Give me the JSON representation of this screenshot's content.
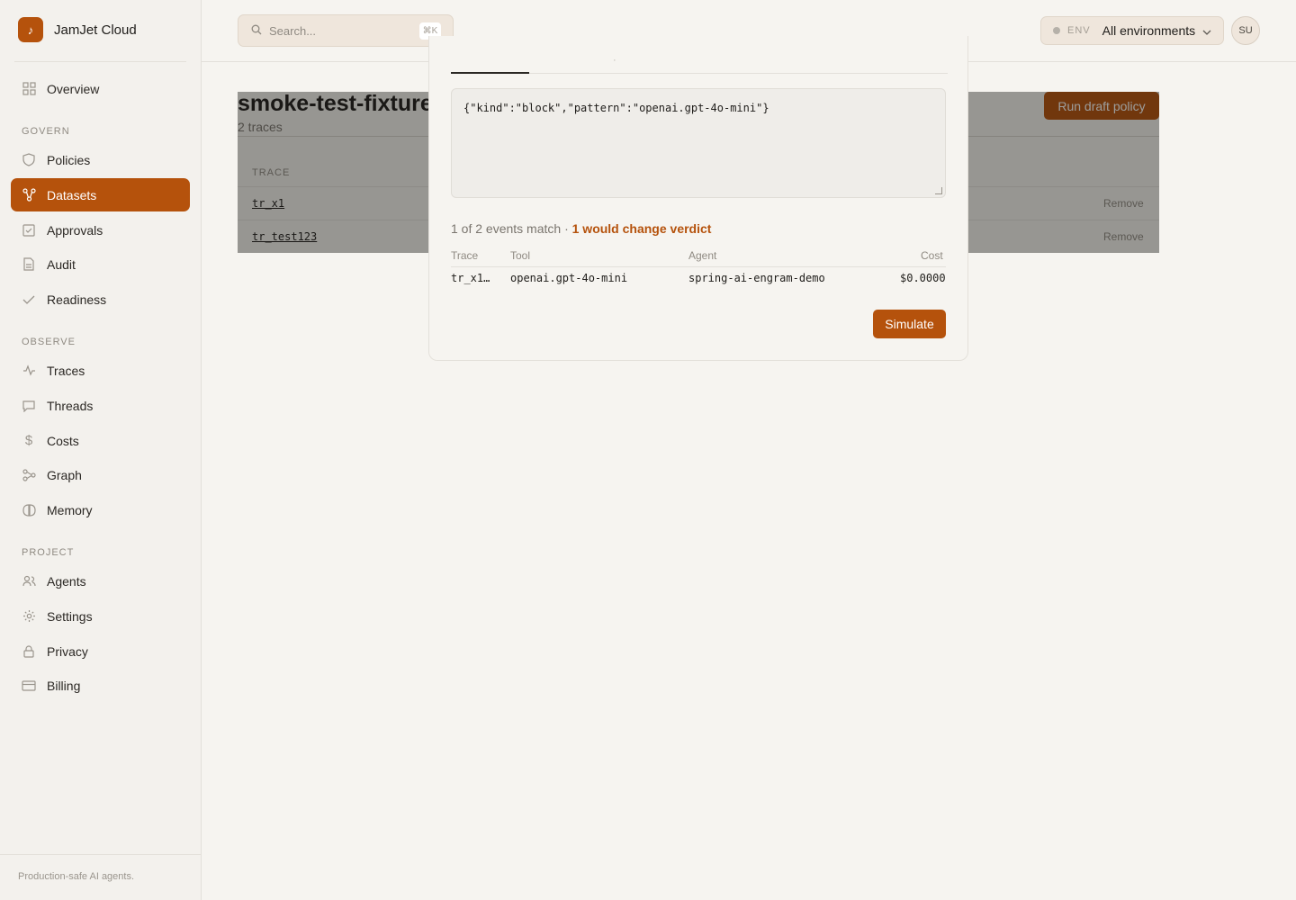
{
  "brand": {
    "name": "JamJet Cloud",
    "logo_glyph": "♪"
  },
  "sidebar": {
    "sections": {
      "govern": "GOVERN",
      "observe": "OBSERVE",
      "project": "PROJECT"
    },
    "items": [
      {
        "label": "Overview",
        "icon": "grid-icon"
      },
      {
        "label": "Policies",
        "icon": "shield-icon"
      },
      {
        "label": "Datasets",
        "icon": "dataset-icon",
        "active": true
      },
      {
        "label": "Approvals",
        "icon": "check-square-icon"
      },
      {
        "label": "Audit",
        "icon": "file-icon"
      },
      {
        "label": "Readiness",
        "icon": "check-icon"
      },
      {
        "label": "Traces",
        "icon": "activity-icon"
      },
      {
        "label": "Threads",
        "icon": "message-icon"
      },
      {
        "label": "Costs",
        "icon": "dollar-icon"
      },
      {
        "label": "Graph",
        "icon": "graph-icon"
      },
      {
        "label": "Memory",
        "icon": "memory-icon"
      },
      {
        "label": "Agents",
        "icon": "users-icon"
      },
      {
        "label": "Settings",
        "icon": "gear-icon"
      },
      {
        "label": "Privacy",
        "icon": "lock-icon"
      },
      {
        "label": "Billing",
        "icon": "card-icon"
      }
    ],
    "footer": "Production-safe AI agents."
  },
  "topbar": {
    "search_placeholder": "Search...",
    "search_shortcut": "⌘K",
    "env_label": "ENV",
    "env_value": "All environments",
    "avatar_initials": "SU"
  },
  "dataset": {
    "title": "smoke-test-fixture",
    "subtitle": "2 traces",
    "run_button": "Run draft policy",
    "column_trace": "TRACE",
    "rows": [
      {
        "trace": "tr_x1",
        "action": "Remove"
      },
      {
        "trace": "tr_test123",
        "action": "Remove"
      }
    ]
  },
  "modal": {
    "policy_json": "{\"kind\":\"block\",\"pattern\":\"openai.gpt-4o-mini\"}",
    "summary_text": "1 of 2 events match · ",
    "summary_warn": "1 would change verdict",
    "columns": {
      "trace": "Trace",
      "tool": "Tool",
      "agent": "Agent",
      "cost": "Cost"
    },
    "result": {
      "trace": "tr_x1…",
      "tool": "openai.gpt-4o-mini",
      "agent": "spring-ai-engram-demo",
      "cost": "$0.0000"
    },
    "simulate_button": "Simulate"
  },
  "colors": {
    "accent": "#b5520c",
    "background": "#f6f4f0",
    "sidebar": "#f3f1ed"
  }
}
